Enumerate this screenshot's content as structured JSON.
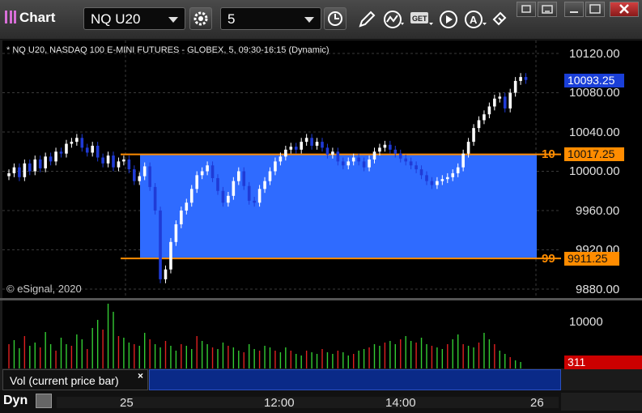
{
  "window": {
    "title": "Chart",
    "symbol": "NQ U20",
    "interval": "5"
  },
  "chart": {
    "header": "* NQ U20, NASDAQ 100 E-MINI FUTURES - GLOBEX, 5, 09:30-16:15 (Dynamic)",
    "copyright": "© eSignal, 2020",
    "price_labels": [
      "10120.00",
      "10080.00",
      "10040.00",
      "10000.00",
      "9960.00",
      "9920.00",
      "9880.00"
    ],
    "last_price": "10093.25",
    "upper_level": {
      "label": "10",
      "price": "10017.25"
    },
    "lower_level": {
      "label": "99",
      "price": "9911.25"
    },
    "colors": {
      "up": "#ffffff",
      "down": "#1f3bd6",
      "zone": "#2f6bff",
      "level_line": "#ff8c00",
      "price_tag": "#1a3fd8"
    }
  },
  "volume": {
    "legend": "Vol (current price bar)",
    "close_label": "×",
    "axis_label": "10000",
    "current_value": "311",
    "colors": {
      "up": "#33cc33",
      "down": "#e02020",
      "value_tag": "#cc0000"
    }
  },
  "time_axis": {
    "labels": [
      "25",
      "12:00",
      "14:00",
      "26"
    ],
    "mode": "Dyn"
  }
}
